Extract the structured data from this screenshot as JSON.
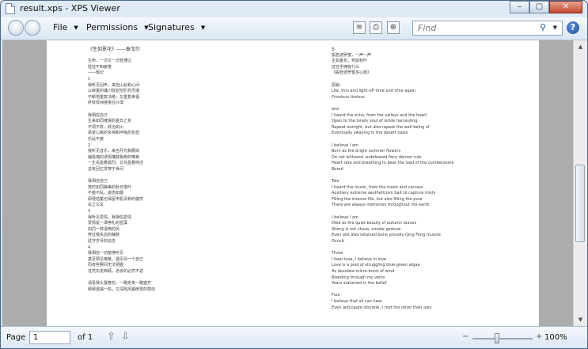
{
  "window": {
    "title": "result.xps - XPS Viewer"
  },
  "title_buttons": {
    "minimize": "–",
    "maximize": "▢",
    "close": "✕"
  },
  "toolbar": {
    "menus": [
      {
        "label": "File"
      },
      {
        "label": "Permissions"
      },
      {
        "label": "Signatures"
      }
    ],
    "search_placeholder": "Find",
    "help_label": "?"
  },
  "document": {
    "left_column": [
      {
        "text": "《生如夏花》——泰戈尔",
        "head": true
      },
      {
        "text": ""
      },
      {
        "text": "生命，一次又一次轻薄过"
      },
      {
        "text": "轻狂不知疲倦"
      },
      {
        "text": "        ——题记"
      },
      {
        "text": "1"
      },
      {
        "text": "我听见回声，来自山谷和心间"
      },
      {
        "text": "以寂寞的镰刀收割空旷的灵魂"
      },
      {
        "text": "不断地重复决绝，又重复幸福"
      },
      {
        "text": "终有绿洲摇曳在沙漠"
      },
      {
        "text": ""
      },
      {
        "text": "我相信自己"
      },
      {
        "text": "生来如同璀璨的夏日之花"
      },
      {
        "text": "不凋不败，妖冶如火"
      },
      {
        "text": "承受心跳的负荷和呼吸的负担"
      },
      {
        "text": "乐此不疲"
      },
      {
        "text": "2"
      },
      {
        "text": "我听见音乐，来自月光和胴体"
      },
      {
        "text": "辅极端的诱饵捕获飘渺的唯美"
      },
      {
        "text": "一生充盈着激烈，又充盈着纯洁"
      },
      {
        "text": "总有回忆贯穿于世间"
      },
      {
        "text": ""
      },
      {
        "text": "我相信自己"
      },
      {
        "text": "死时如同静美的秋日落叶"
      },
      {
        "text": "不盛不乱，姿态如烟"
      },
      {
        "text": "即便枯萎也保留丰肌清骨的傲然"
      },
      {
        "text": "玄之又玄"
      },
      {
        "text": "3"
      },
      {
        "text": "我听见爱情，我相信爱情"
      },
      {
        "text": "爱情是一潭挣扎的蓝藻"
      },
      {
        "text": "如同一阵凄微的风"
      },
      {
        "text": "穿过我失血的静脉"
      },
      {
        "text": "驻守岁月的信念"
      },
      {
        "text": "4"
      },
      {
        "text": "我相信一切能够听见"
      },
      {
        "text": "甚至预见离散，遇见另一个自己"
      },
      {
        "text": "而有些瞬间无法把握"
      },
      {
        "text": "任凭东走西顾，逝去的必然不返"
      },
      {
        "text": ""
      },
      {
        "text": "请看我头置簪花，一路走来一路盛开"
      },
      {
        "text": "频频遗漏一些，又深陷风霜雨雪的感动"
      }
    ],
    "right_column": [
      {
        "text": "5",
        "head": true
      },
      {
        "text": "般若波罗蜜，一声一声"
      },
      {
        "text": "生如夏花，死如秋叶"
      },
      {
        "text": "还在乎拥有什么"
      },
      {
        "text": "《般若波罗蜜多心经》"
      },
      {
        "text": ""
      },
      {
        "text": "原版："
      },
      {
        "text": "Life, thin and light-off time and time again"
      },
      {
        "text": "Frivolous tireless"
      },
      {
        "text": ""
      },
      {
        "text": "one"
      },
      {
        "text": "I heard the echo, from the valleys and the heart"
      },
      {
        "text": "Open to the lonely soul of sickle harvesting"
      },
      {
        "text": "Repeat outright, but also repeat the well-being of"
      },
      {
        "text": "Eventually swaying in the desert oasis"
      },
      {
        "text": ""
      },
      {
        "text": "I believe I am"
      },
      {
        "text": "Born as the bright summer flowers"
      },
      {
        "text": "Do not withered undefeated fiery demon rule"
      },
      {
        "text": "Heart rate and breathing to bear the load of the cumbersome"
      },
      {
        "text": "Bored"
      },
      {
        "text": ""
      },
      {
        "text": "Two"
      },
      {
        "text": "I heard the music, from the moon and carcass"
      },
      {
        "text": "Auxiliary extreme aestheticism bait to capture misty"
      },
      {
        "text": "Filling the intense life, but also filling the pure"
      },
      {
        "text": "There are always memories throughout the earth"
      },
      {
        "text": ""
      },
      {
        "text": "I believe I am"
      },
      {
        "text": "Died as the quiet beauty of autumn leaves"
      },
      {
        "text": "Sheng is not chaos, smoke gesture"
      },
      {
        "text": "Even wilt also retained bone proudly Qing Feng muscle"
      },
      {
        "text": "Occult"
      },
      {
        "text": ""
      },
      {
        "text": "Three"
      },
      {
        "text": "I hear love, I believe in love"
      },
      {
        "text": "Love is a pool of struggling blue-green algae"
      },
      {
        "text": "As desolate micro-burst of wind"
      },
      {
        "text": "Bleeding through my veins"
      },
      {
        "text": "Years stationed in the belief"
      },
      {
        "text": ""
      },
      {
        "text": "Four"
      },
      {
        "text": "I believe that all can hear"
      },
      {
        "text": "Even anticipate discrete, I met the other their own"
      }
    ]
  },
  "statusbar": {
    "page_label": "Page",
    "page_value": "1",
    "of_label": "of 1",
    "prev_icon": "⇧",
    "next_icon": "⇩",
    "zoom_minus": "−",
    "zoom_plus": "+",
    "zoom_percent": "100%",
    "zoom_level": 0.4
  }
}
